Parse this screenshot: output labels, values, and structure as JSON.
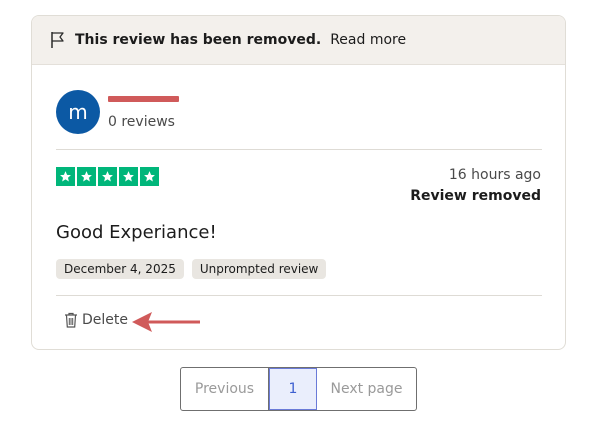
{
  "banner": {
    "icon": "flag-icon",
    "text": "This review has been removed.",
    "link": "Read more"
  },
  "reviewer": {
    "initial": "m",
    "reviews_count": "0 reviews"
  },
  "review": {
    "rating": 5,
    "rating_max": 5,
    "star_color": "#00b67a",
    "time_ago": "16 hours ago",
    "status": "Review removed",
    "title": "Good Experiance!",
    "tags": [
      "December 4, 2025",
      "Unprompted review"
    ]
  },
  "actions": {
    "delete_label": "Delete",
    "delete_icon": "trash-icon"
  },
  "annotation": {
    "arrow_color": "#d05a5a",
    "redaction_color": "#d05a5a"
  },
  "pagination": {
    "previous": "Previous",
    "current": "1",
    "next": "Next page"
  }
}
